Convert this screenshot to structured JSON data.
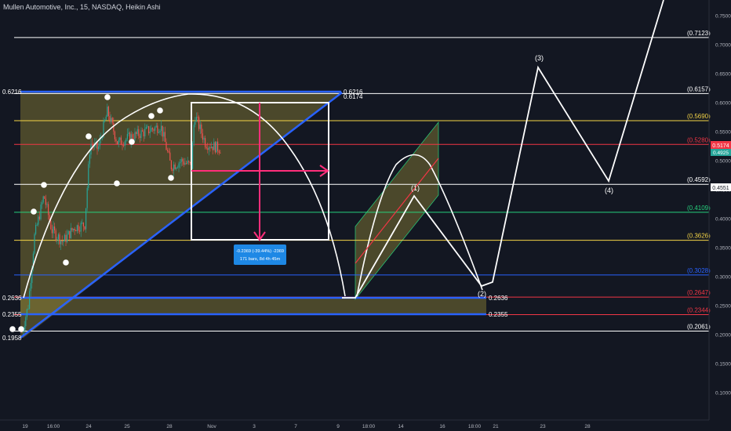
{
  "header": {
    "title": "Mullen Automotive, Inc., 15, NASDAQ, Heikin Ashi"
  },
  "colors": {
    "background": "#131722",
    "white": "#ffffff",
    "blue": "#2962ff",
    "yellow": "#f5d547",
    "red": "#f23645",
    "green": "#26d07c",
    "pink": "#ff2e7a",
    "fill": "rgba(152,140,58,0.42)",
    "label_blue": "#1e88e5"
  },
  "chart_data": {
    "type": "line",
    "series_type": "heikin-ashi candles with drawn annotations",
    "price_axis": {
      "ticks": [
        "0.7500",
        "0.7000",
        "0.6500",
        "0.6000",
        "0.5500",
        "0.5000",
        "0.4500",
        "0.4000",
        "0.3500",
        "0.3000",
        "0.2500",
        "0.2000",
        "0.1500",
        "0.1000"
      ],
      "current_price": "0.5174",
      "current_price_sub": "0.4925",
      "crosshair_price": "0.4551"
    },
    "time_axis": {
      "ticks": [
        "19",
        "16:00",
        "24",
        "25",
        "28",
        "Nov",
        "3",
        "7",
        "9",
        "18:00",
        "14",
        "16",
        "18:00",
        "21",
        "23",
        "28"
      ]
    },
    "fib_levels": [
      {
        "label": "(0.7123)",
        "value": 0.7123,
        "color": "#ffffff"
      },
      {
        "label": "(0.6157)",
        "value": 0.6157,
        "color": "#ffffff"
      },
      {
        "label": "(0.5690)",
        "value": 0.569,
        "color": "#f5d547"
      },
      {
        "label": "(0.5280)",
        "value": 0.528,
        "color": "#f23645"
      },
      {
        "label": "(0.4592)",
        "value": 0.4592,
        "color": "#ffffff"
      },
      {
        "label": "(0.4109)",
        "value": 0.4109,
        "color": "#26d07c"
      },
      {
        "label": "(0.3626)",
        "value": 0.3626,
        "color": "#f5d547"
      },
      {
        "label": "(0.3028)",
        "value": 0.3028,
        "color": "#2962ff"
      },
      {
        "label": "(0.2647)",
        "value": 0.2647,
        "color": "#f23645"
      },
      {
        "label": "(0.2344)",
        "value": 0.2344,
        "color": "#f23645"
      },
      {
        "label": "(0.2061)",
        "value": 0.2061,
        "color": "#ffffff"
      }
    ],
    "left_labels": [
      "0.6216",
      "0.2636",
      "0.2355",
      "0.1958"
    ],
    "channel_labels": [
      "0.6216",
      "0.6174"
    ],
    "target_labels": [
      "0.2636",
      "0.2355"
    ],
    "wave_labels": [
      "(1)",
      "(2)",
      "(3)",
      "(4)"
    ],
    "measure_box": {
      "line1": "-0.2369 (-39.44%) -2369",
      "line2": "171 bars, 8d 4h 45m"
    }
  }
}
